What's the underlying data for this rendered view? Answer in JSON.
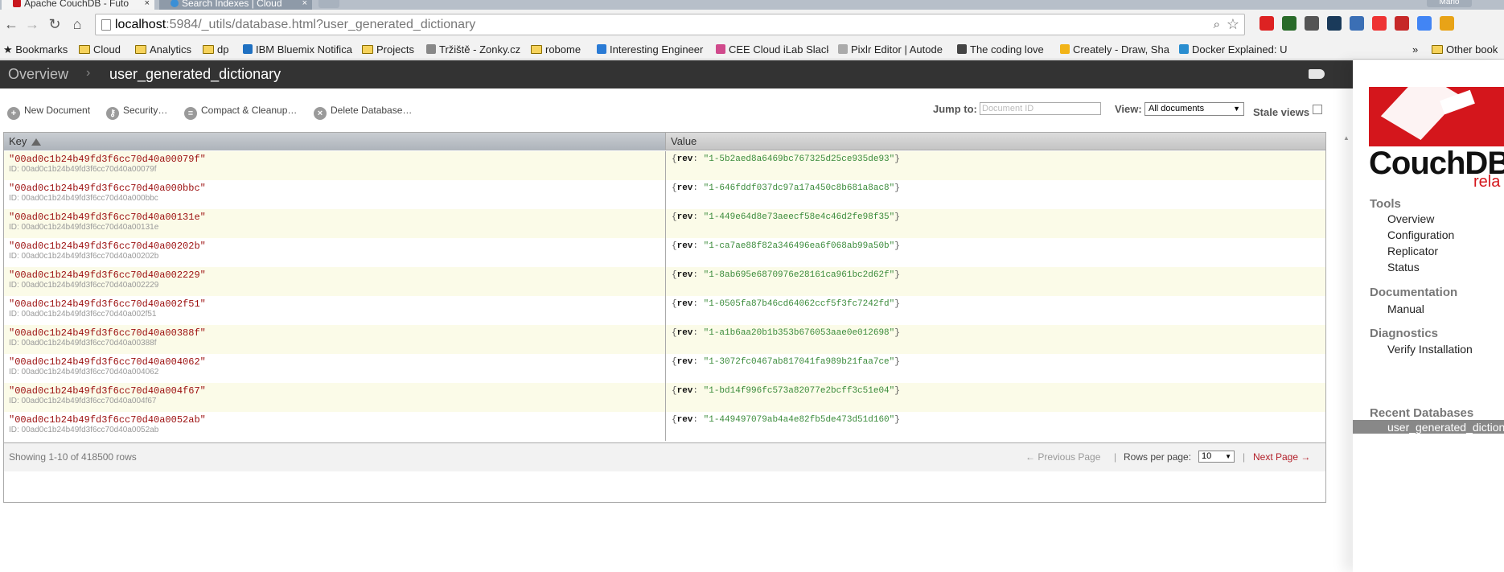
{
  "browser": {
    "tabs": [
      {
        "label": "Apache CouchDB - Futo"
      },
      {
        "label": "Search Indexes | Cloud"
      }
    ],
    "profile": "Mario",
    "url": {
      "host": "localhost",
      "rest": ":5984/_utils/database.html?user_generated_dictionary"
    },
    "bookmarks": [
      {
        "label": "Bookmarks",
        "kind": "star"
      },
      {
        "label": "Cloud",
        "kind": "folder"
      },
      {
        "label": "Analytics",
        "kind": "folder"
      },
      {
        "label": "dp",
        "kind": "folder"
      },
      {
        "label": "IBM Bluemix Notifica",
        "kind": "site",
        "color": "#1f70c1"
      },
      {
        "label": "Projects",
        "kind": "folder"
      },
      {
        "label": "Tržiště - Zonky.cz",
        "kind": "site",
        "color": "#888888"
      },
      {
        "label": "robome",
        "kind": "folder"
      },
      {
        "label": "Interesting Engineer",
        "kind": "site",
        "color": "#2a7bd5"
      },
      {
        "label": "CEE Cloud iLab Slack",
        "kind": "site",
        "color": "#d04a8c"
      },
      {
        "label": "Pixlr Editor | Autode",
        "kind": "site",
        "color": "#aaaaaa"
      },
      {
        "label": "The coding love",
        "kind": "site",
        "color": "#444444"
      },
      {
        "label": "Creately - Draw, Sha",
        "kind": "site",
        "color": "#f2b418"
      },
      {
        "label": "Docker Explained: U",
        "kind": "site",
        "color": "#2a8ed0"
      },
      {
        "label": "Other book",
        "kind": "folder"
      }
    ]
  },
  "header": {
    "breadcrumb_home": "Overview",
    "breadcrumb_sep": "›",
    "database": "user_generated_dictionary"
  },
  "actions": [
    {
      "label": "New Document",
      "icon": "plus-icon"
    },
    {
      "label": "Security…",
      "icon": "key-icon"
    },
    {
      "label": "Compact & Cleanup…",
      "icon": "broom-icon"
    },
    {
      "label": "Delete Database…",
      "icon": "delete-icon"
    }
  ],
  "controls": {
    "jump_label": "Jump to:",
    "jump_placeholder": "Document ID",
    "view_label": "View:",
    "view_selected": "All documents",
    "stale_label": "Stale views"
  },
  "table": {
    "columns": {
      "key": "Key",
      "value": "Value"
    },
    "rows": [
      {
        "key": "\"00ad0c1b24b49fd3f6cc70d40a00079f\"",
        "id": "ID: 00ad0c1b24b49fd3f6cc70d40a00079f",
        "rev": "\"1-5b2aed8a6469bc767325d25ce935de93\""
      },
      {
        "key": "\"00ad0c1b24b49fd3f6cc70d40a000bbc\"",
        "id": "ID: 00ad0c1b24b49fd3f6cc70d40a000bbc",
        "rev": "\"1-646fddf037dc97a17a450c8b681a8ac8\""
      },
      {
        "key": "\"00ad0c1b24b49fd3f6cc70d40a00131e\"",
        "id": "ID: 00ad0c1b24b49fd3f6cc70d40a00131e",
        "rev": "\"1-449e64d8e73aeecf58e4c46d2fe98f35\""
      },
      {
        "key": "\"00ad0c1b24b49fd3f6cc70d40a00202b\"",
        "id": "ID: 00ad0c1b24b49fd3f6cc70d40a00202b",
        "rev": "\"1-ca7ae88f82a346496ea6f068ab99a50b\""
      },
      {
        "key": "\"00ad0c1b24b49fd3f6cc70d40a002229\"",
        "id": "ID: 00ad0c1b24b49fd3f6cc70d40a002229",
        "rev": "\"1-8ab695e6870976e28161ca961bc2d62f\""
      },
      {
        "key": "\"00ad0c1b24b49fd3f6cc70d40a002f51\"",
        "id": "ID: 00ad0c1b24b49fd3f6cc70d40a002f51",
        "rev": "\"1-0505fa87b46cd64062ccf5f3fc7242fd\""
      },
      {
        "key": "\"00ad0c1b24b49fd3f6cc70d40a00388f\"",
        "id": "ID: 00ad0c1b24b49fd3f6cc70d40a00388f",
        "rev": "\"1-a1b6aa20b1b353b676053aae0e012698\""
      },
      {
        "key": "\"00ad0c1b24b49fd3f6cc70d40a004062\"",
        "id": "ID: 00ad0c1b24b49fd3f6cc70d40a004062",
        "rev": "\"1-3072fc0467ab817041fa989b21faa7ce\""
      },
      {
        "key": "\"00ad0c1b24b49fd3f6cc70d40a004f67\"",
        "id": "ID: 00ad0c1b24b49fd3f6cc70d40a004f67",
        "rev": "\"1-bd14f996fc573a82077e2bcff3c51e04\""
      },
      {
        "key": "\"00ad0c1b24b49fd3f6cc70d40a0052ab\"",
        "id": "ID: 00ad0c1b24b49fd3f6cc70d40a0052ab",
        "rev": "\"1-449497079ab4a4e82fb5de473d51d160\""
      }
    ],
    "rev_key": "rev"
  },
  "footer": {
    "showing": "Showing 1-10 of 418500 rows",
    "prev": "← Previous Page",
    "separator": "|",
    "rows_per_page_label": "Rows per page:",
    "rows_per_page": "10",
    "next": "Next Page →"
  },
  "sidebar": {
    "logo_text": "CouchDB",
    "logo_sub": "rela",
    "tools_heading": "Tools",
    "tools": [
      "Overview",
      "Configuration",
      "Replicator",
      "Status"
    ],
    "docs_heading": "Documentation",
    "docs": [
      "Manual"
    ],
    "diag_heading": "Diagnostics",
    "diag": [
      "Verify Installation"
    ],
    "recent_heading": "Recent Databases",
    "recent": [
      "user_generated_dictionary"
    ]
  },
  "colors": {
    "topbar": "#333333",
    "key_text": "#9c0f0f",
    "rev_text": "#3a8b3a",
    "row_odd": "#fbfbe8",
    "logo_red": "#d4161c",
    "next_link": "#b3202a"
  }
}
